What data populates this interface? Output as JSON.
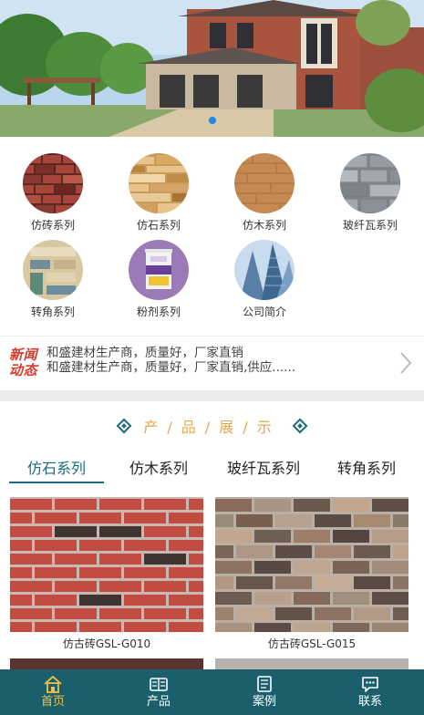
{
  "categories": [
    {
      "label": "仿砖系列",
      "icon": "red-brick-icon"
    },
    {
      "label": "仿石系列",
      "icon": "stone-icon"
    },
    {
      "label": "仿木系列",
      "icon": "wood-icon"
    },
    {
      "label": "玻纤瓦系列",
      "icon": "grey-tile-icon"
    },
    {
      "label": "转角系列",
      "icon": "corner-icon"
    },
    {
      "label": "粉剂系列",
      "icon": "powder-bucket-icon"
    },
    {
      "label": "公司简介",
      "icon": "building-icon"
    }
  ],
  "news": {
    "logo_line1": "新闻",
    "logo_line2": "动态",
    "line1": "和盛建材生产商，质量好，厂家直销",
    "line2": "和盛建材生产商，质量好，厂家直销,供应......"
  },
  "products_heading": "产/品/展/示",
  "tabs": [
    "仿石系列",
    "仿木系列",
    "玻纤瓦系列",
    "转角系列"
  ],
  "products": [
    {
      "caption": "仿古砖GSL-G010"
    },
    {
      "caption": "仿古砖GSL-G015"
    }
  ],
  "bottom_nav": [
    {
      "label": "首页",
      "icon": "home-icon"
    },
    {
      "label": "产品",
      "icon": "product-icon"
    },
    {
      "label": "案例",
      "icon": "case-icon"
    },
    {
      "label": "联系",
      "icon": "chat-icon"
    }
  ],
  "colors": {
    "accent": "#1b6b7f",
    "nav_bg": "#1b5f6c",
    "nav_active": "#f0c04a",
    "heading": "#e5a84b",
    "news_logo": "#d93b2b"
  }
}
